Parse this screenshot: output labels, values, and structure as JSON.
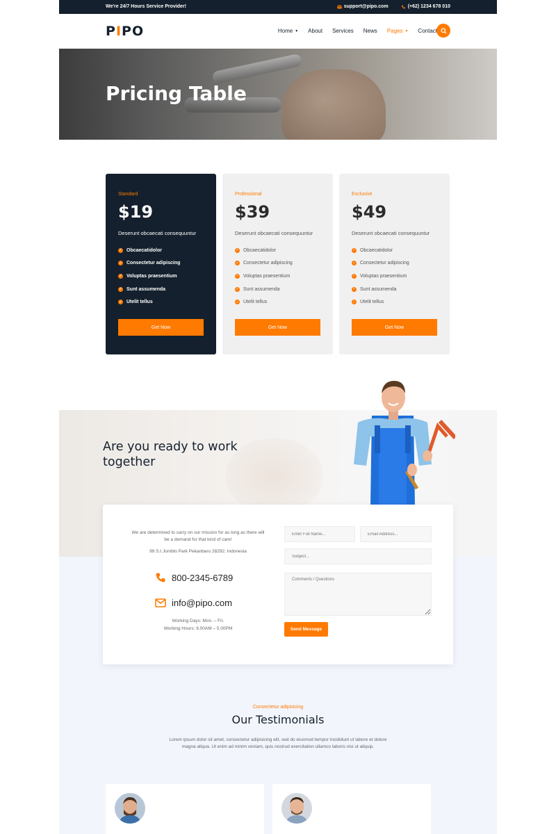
{
  "topbar": {
    "promo": "We're 24/7 Hours Service Provider!",
    "email": "support@pipo.com",
    "phone": "(+62) 1234 678 010"
  },
  "header": {
    "logo_prefix": "P",
    "logo_accent": "I",
    "logo_suffix": "PO",
    "nav": [
      {
        "label": "Home",
        "has_caret": true,
        "active": false
      },
      {
        "label": "About",
        "has_caret": false,
        "active": false
      },
      {
        "label": "Services",
        "has_caret": false,
        "active": false
      },
      {
        "label": "News",
        "has_caret": false,
        "active": false
      },
      {
        "label": "Pages",
        "has_caret": true,
        "active": true
      },
      {
        "label": "Contact",
        "has_caret": false,
        "active": false
      }
    ],
    "search_icon": "search-icon"
  },
  "hero": {
    "title": "Pricing Table"
  },
  "pricing": {
    "plans": [
      {
        "name": "Standard",
        "price": "$19",
        "description": "Deserunt obcaecati consequuntur",
        "features": [
          "Obcaecatidolor",
          "Consectetur adipiscing",
          "Voluptas praesentium",
          "Sunt assumenda",
          "Utelit tellus"
        ],
        "button": "Get Now",
        "featured": true
      },
      {
        "name": "Professional",
        "price": "$39",
        "description": "Deserunt obcaecati consequuntur",
        "features": [
          "Obcaecatidolor",
          "Consectetur adipiscing",
          "Voluptas praesentium",
          "Sunt assumenda",
          "Utelit tellus"
        ],
        "button": "Get Now",
        "featured": false
      },
      {
        "name": "Exclusive",
        "price": "$49",
        "description": "Deserunt obcaecati consequuntur",
        "features": [
          "Obcaecatidolor",
          "Consectetur adipiscing",
          "Voluptas praesentium",
          "Sunt assumenda",
          "Utelit tellus"
        ],
        "button": "Get Now",
        "featured": false
      }
    ]
  },
  "cta": {
    "title": "Are you ready to work together"
  },
  "contact": {
    "mission": "We are determined to carry on our mission for as long as there will be a demand for that kind of care!",
    "address": "99 S.t Jomblo Park Pekanbaru 28292. Indonesia",
    "phone": "800-2345-6789",
    "email": "info@pipo.com",
    "working_days": "Working Days: Mon. – Fri.",
    "working_hours": "Working Hours: 9.00AM – 5.00PM",
    "form": {
      "name_placeholder": "Enter Full Name...",
      "email_placeholder": "Email Address...",
      "subject_placeholder": "Subject...",
      "comment_placeholder": "Comments / Questions",
      "send_label": "Send Message"
    }
  },
  "testimonials": {
    "eyebrow": "Consectetur adipisicing",
    "title": "Our Testimonials",
    "body": "Lorem ipsum dolor sit amet, consectetur adipisicing elit, sed do eiusmod tempor incididunt ut labore et dolore magna aliqua. Ut enim ad minim veniam, quis nostrud exercitation ullamco laboris nisi ut aliquip."
  },
  "colors": {
    "accent": "#ff7a00",
    "dark": "#14202d",
    "light_bg": "#f2f5fc",
    "plan_bg": "#f0f0f0"
  }
}
